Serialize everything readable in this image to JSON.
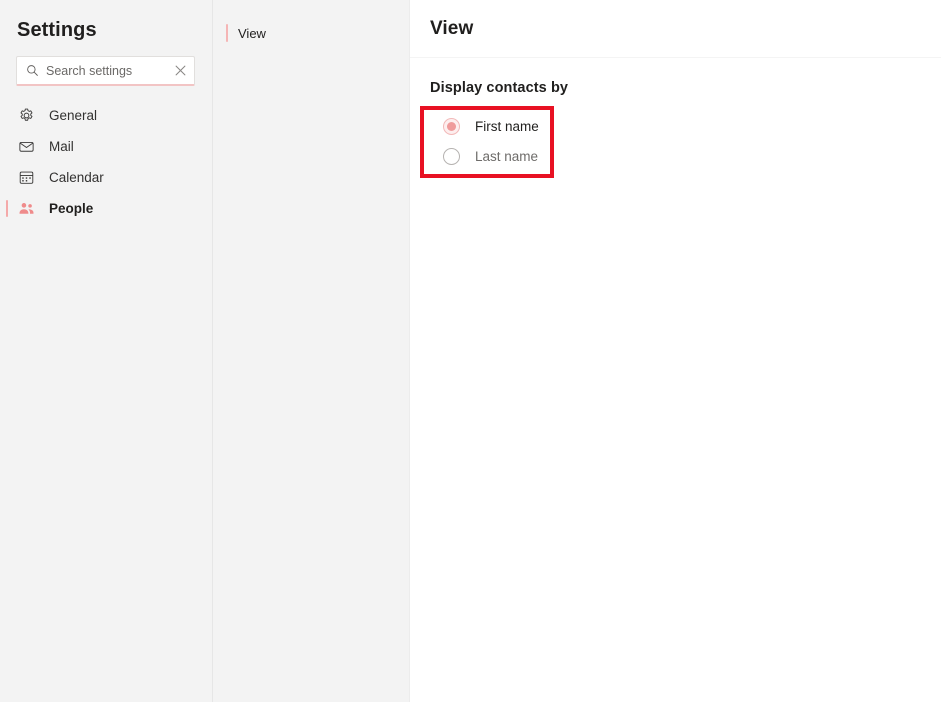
{
  "settings_pane": {
    "title": "Settings",
    "search": {
      "placeholder": "Search settings",
      "value": "",
      "search_icon": "search-icon",
      "clear_icon": "close-icon"
    },
    "nav_items": [
      {
        "label": "General",
        "icon": "gear-icon",
        "selected": false
      },
      {
        "label": "Mail",
        "icon": "envelope-icon",
        "selected": false
      },
      {
        "label": "Calendar",
        "icon": "calendar-icon",
        "selected": false
      },
      {
        "label": "People",
        "icon": "people-icon",
        "selected": true
      }
    ]
  },
  "sub_pane": {
    "items": [
      {
        "label": "View",
        "active": true
      }
    ]
  },
  "detail_pane": {
    "title": "View",
    "section": {
      "heading": "Display contacts by",
      "options": [
        {
          "label": "First name",
          "checked": true
        },
        {
          "label": "Last name",
          "checked": false
        }
      ]
    }
  },
  "annotation": {
    "highlight_color": "#e81123"
  },
  "colors": {
    "accent": "#ef9b9b",
    "sidebar_bg": "#f3f3f3",
    "panel_bg": "#ffffff",
    "text_primary": "#201f1e",
    "text_secondary": "#6e6c6a"
  }
}
